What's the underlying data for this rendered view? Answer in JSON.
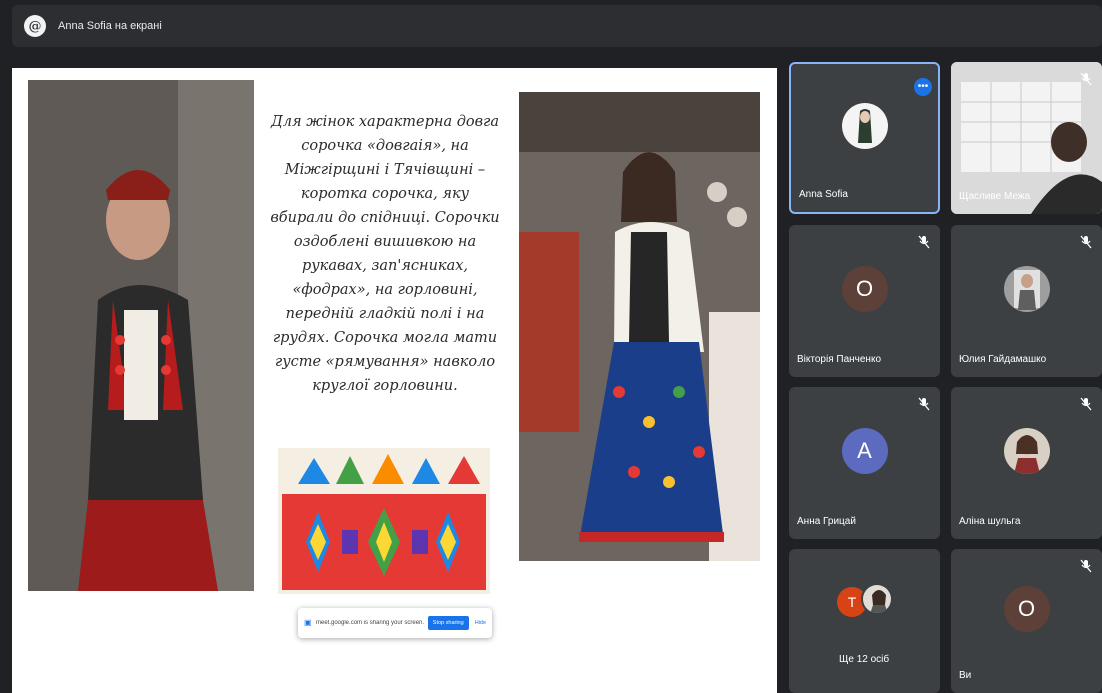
{
  "presenter_bar": {
    "avatar_glyph": "@",
    "title": "Anna Sofia на екрані"
  },
  "slide": {
    "text": "Для жінок характерна довга сорочка «довгаія», на Міжгірщині і Тячівщині – коротка сорочка, яку вбирали до спідниці. Сорочки оздоблені вишивкою на рукавах, зап'ясниках, «фодрах», на горловині, передній гладкій полі і на грудях. Сорочка могла мати густе «рямування» навколо круглої горловини.",
    "share_bar": {
      "text": "meet.google.com is sharing your screen.",
      "stop_label": "Stop sharing",
      "hide_label": "Hide"
    }
  },
  "participants": [
    {
      "name": "Anna Sofia",
      "type": "photo",
      "active": true,
      "more": "•••"
    },
    {
      "name": "Щасливе Межа",
      "type": "video",
      "muted": true
    },
    {
      "name": "Вікторія Панченко",
      "type": "letter",
      "letter": "О",
      "color": "#5d4037",
      "muted": true
    },
    {
      "name": "Юлия Гайдамашко",
      "type": "photo",
      "muted": true
    },
    {
      "name": "Анна Грицай",
      "type": "letter",
      "letter": "А",
      "color": "#5c6bc0",
      "muted": true
    },
    {
      "name": "Аліна шульга",
      "type": "photo",
      "muted": true
    },
    {
      "name": "Ще 12 осіб",
      "type": "group",
      "letter": "Т",
      "color": "#d84315"
    },
    {
      "name": "Ви",
      "type": "letter",
      "letter": "О",
      "color": "#5d4037",
      "muted": true
    }
  ]
}
